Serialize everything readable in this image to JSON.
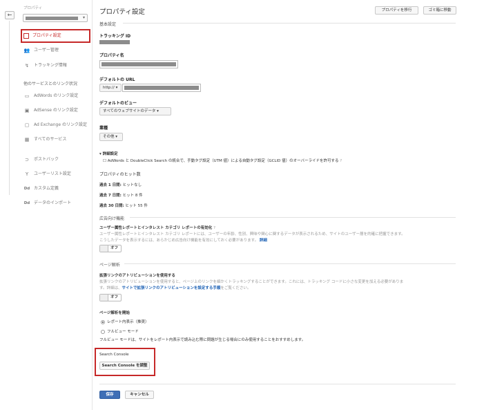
{
  "sidebar": {
    "back_icon": "←",
    "property_label": "プロパティ",
    "property_select_chevron": "▾",
    "items": [
      {
        "icon": "▢",
        "label": "プロパティ設定"
      },
      {
        "icon": "👥",
        "label": "ユーザー管理"
      },
      {
        "icon": "↯",
        "label": "トラッキング情報"
      }
    ],
    "linking_heading": "他のサービスとのリンク状況",
    "link_items": [
      {
        "icon": "▭",
        "label": "AdWords のリンク設定"
      },
      {
        "icon": "▣",
        "label": "AdSense のリンク設定"
      },
      {
        "icon": "▢",
        "label": "Ad Exchange のリンク設定"
      },
      {
        "icon": "▦",
        "label": "すべてのサービス"
      }
    ],
    "other_items": [
      {
        "icon": "⊃",
        "label": "ポストバック"
      },
      {
        "icon": "Y",
        "label": "ユーザーリスト設定"
      },
      {
        "icon": "Dd",
        "label": "カスタム定義"
      },
      {
        "icon": "Dd",
        "label": "データのインポート"
      }
    ]
  },
  "header": {
    "title": "プロパティ設定",
    "move_property": "プロパティを移行",
    "trash": "ゴミ箱に移動"
  },
  "basic": {
    "section": "基本設定",
    "tracking_id_label": "トラッキング ID",
    "property_name_label": "プロパティ名",
    "default_url_label": "デフォルトの URL",
    "protocol": "http:// ▾",
    "default_view_label": "デフォルトのビュー",
    "default_view_value": "すべてのウェブサイトのデータ ▾",
    "industry_label": "業種",
    "industry_value": "その他 ▾",
    "advanced_label": "▾ 詳細設定",
    "advanced_checkbox": "☐",
    "advanced_text": "AdWords と DoubleClick Search の統合で、手動タグ設定（UTM 値）による自動タグ設定（GCLID 値）のオーバーライドを許可する",
    "advanced_help": "?"
  },
  "hits": {
    "title": "プロパティのヒット数",
    "rows": [
      {
        "label": "過去 1 日間:",
        "value": " ヒットなし"
      },
      {
        "label": "過去 7 日間:",
        "value": " ヒット 8 件"
      },
      {
        "label": "過去 30 日間:",
        "value": " ヒット 55 件"
      }
    ]
  },
  "advertising": {
    "section": "広告向け機能",
    "title": "ユーザー属性レポートとインタレスト カテゴリ レポートの有効化",
    "help": "?",
    "desc1": "ユーザー属性レポートとインタレスト カテゴリ レポートには、ユーザーの年齢、性別、興味や関心に関するデータが表示されるため、サイトのユーザー層を的確に把握できます。",
    "desc2": "こうしたデータを表示するには、あらかじめ広告向け機能を有効にしておく必要があります。",
    "desc2_link": "詳細",
    "toggle": "オフ"
  },
  "page_analytics": {
    "section": "ページ解析",
    "title": "拡張リンクのアトリビューションを使用する",
    "desc1": "拡張リンクのアトリビューションを使用すると、ページ上のリンクを細かくトラッキングすることができます。これには、トラッキング コードに小さな変更を加える必要がありま",
    "desc2_pre": "す。詳細は、",
    "desc2_link": "サイトで拡張リンクのアトリビューションを設定する手順",
    "desc2_post": "をご覧ください。",
    "toggle": "オフ",
    "start_label": "ページ解析を開始",
    "radio1": "レポート内表示（推奨）",
    "radio2": "フルビュー モード",
    "note": "フルビュー モードは、サイトをレポート内表示で読み込む際に問題が生じる場合にのみ使用することをおすすめします。"
  },
  "search_console": {
    "title": "Search Console",
    "button": "Search Console を調整"
  },
  "footer": {
    "save": "保存",
    "cancel": "キャンセル"
  }
}
